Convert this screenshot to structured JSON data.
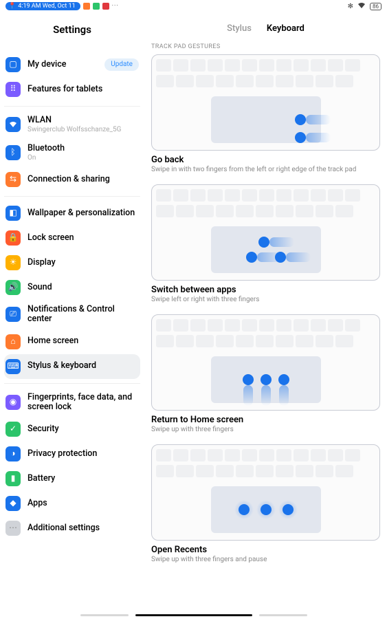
{
  "status": {
    "time": "4:19 AM Wed, Oct 11",
    "battery": "86"
  },
  "settings_title": "Settings",
  "tabs": {
    "stylus": "Stylus",
    "keyboard": "Keyboard"
  },
  "section_label": "TRACK PAD GESTURES",
  "sidebar": {
    "my_device": {
      "label": "My device",
      "badge": "Update"
    },
    "features": {
      "label": "Features for tablets"
    },
    "wlan": {
      "label": "WLAN",
      "sub": "Swingerclub Wolfsschanze_5G"
    },
    "bluetooth": {
      "label": "Bluetooth",
      "sub": "On"
    },
    "connection": {
      "label": "Connection & sharing"
    },
    "wallpaper": {
      "label": "Wallpaper & personalization"
    },
    "lock": {
      "label": "Lock screen"
    },
    "display": {
      "label": "Display"
    },
    "sound": {
      "label": "Sound"
    },
    "notif": {
      "label": "Notifications & Control center"
    },
    "home": {
      "label": "Home screen"
    },
    "stylus_kb": {
      "label": "Stylus & keyboard"
    },
    "biometrics": {
      "label": "Fingerprints, face data, and screen lock"
    },
    "security": {
      "label": "Security"
    },
    "privacy": {
      "label": "Privacy protection"
    },
    "battery": {
      "label": "Battery"
    },
    "apps": {
      "label": "Apps"
    },
    "additional": {
      "label": "Additional settings"
    }
  },
  "gestures": {
    "go_back": {
      "title": "Go back",
      "sub": "Swipe in with two fingers from the left or right edge of the track pad"
    },
    "switch": {
      "title": "Switch between apps",
      "sub": "Swipe left or right with three fingers"
    },
    "home": {
      "title": "Return to Home screen",
      "sub": "Swipe up with three fingers"
    },
    "recents": {
      "title": "Open Recents",
      "sub": "Swipe up with three fingers and pause"
    }
  }
}
